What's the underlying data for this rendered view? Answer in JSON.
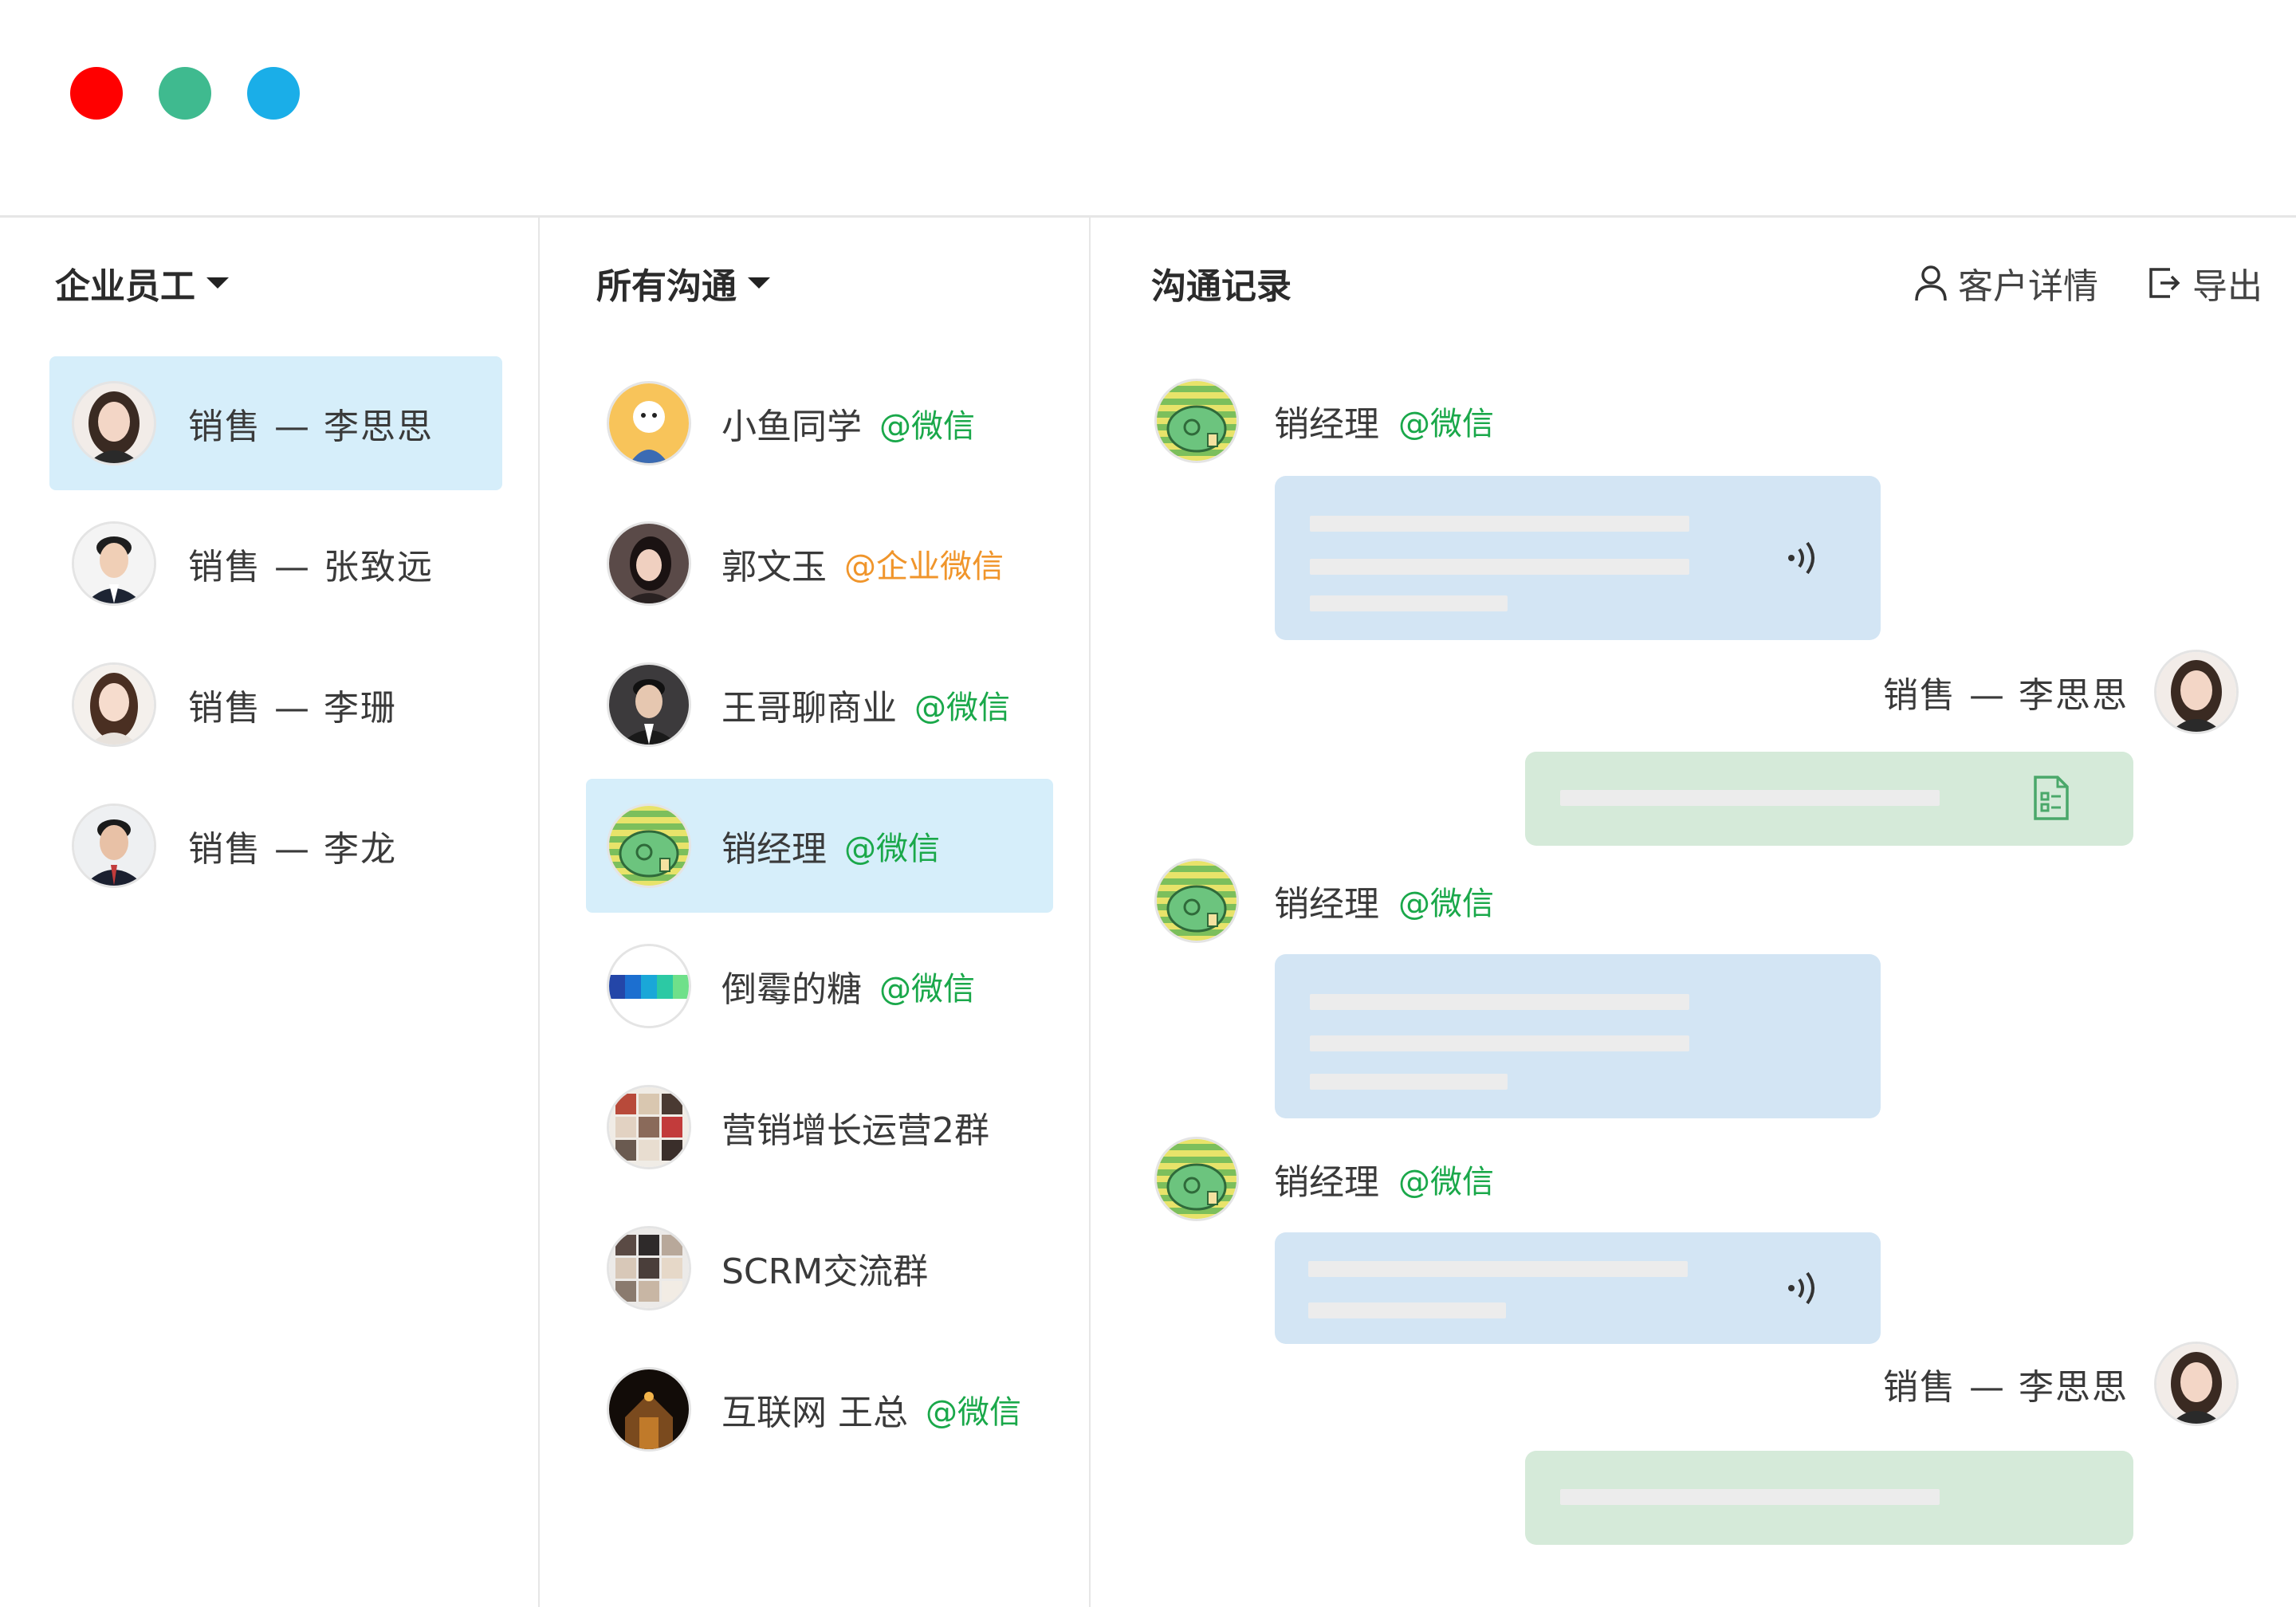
{
  "window": {
    "controls": [
      {
        "name": "close",
        "color": "#ff0000"
      },
      {
        "name": "minimize",
        "color": "#3fba8f"
      },
      {
        "name": "maximize",
        "color": "#1aaee8"
      }
    ]
  },
  "employees": {
    "title": "企业员工",
    "items": [
      {
        "name": "销售 — 李思思",
        "selected": true,
        "avatar": "avatar-female-1"
      },
      {
        "name": "销售 — 张致远",
        "selected": false,
        "avatar": "avatar-male-1"
      },
      {
        "name": "销售 — 李珊",
        "selected": false,
        "avatar": "avatar-female-2"
      },
      {
        "name": "销售 — 李龙",
        "selected": false,
        "avatar": "avatar-male-2"
      }
    ]
  },
  "conversations": {
    "title": "所有沟通",
    "items": [
      {
        "name": "小鱼同学",
        "source": "@微信",
        "source_color": "#1aa84a",
        "selected": false,
        "avatar": "cartoon-avatar"
      },
      {
        "name": "郭文玉",
        "source": "@企业微信",
        "source_color": "#f0952b",
        "selected": false,
        "avatar": "photo-avatar"
      },
      {
        "name": "王哥聊商业",
        "source": "@微信",
        "source_color": "#1aa84a",
        "selected": false,
        "avatar": "photo-avatar"
      },
      {
        "name": "销经理",
        "source": "@微信",
        "source_color": "#1aa84a",
        "selected": true,
        "avatar": "elephant-avatar"
      },
      {
        "name": "倒霉的糖",
        "source": "@微信",
        "source_color": "#1aa84a",
        "selected": false,
        "avatar": "color-bars-avatar"
      },
      {
        "name": "营销增长运营2群",
        "source": "",
        "source_color": "#1aa84a",
        "selected": false,
        "avatar": "group-avatar"
      },
      {
        "name": "SCRM交流群",
        "source": "",
        "source_color": "#1aa84a",
        "selected": false,
        "avatar": "group-avatar"
      },
      {
        "name": "互联网 王总",
        "source": "@微信",
        "source_color": "#1aa84a",
        "selected": false,
        "avatar": "photo-avatar"
      }
    ]
  },
  "records": {
    "title": "沟通记录",
    "customer_detail": "客户详情",
    "export": "导出",
    "messages": [
      {
        "sender": "销经理",
        "source": "@微信",
        "side": "left",
        "bubble": "blue",
        "icon": "voice-icon"
      },
      {
        "sender": "销售 — 李思思",
        "source": "",
        "side": "right",
        "bubble": "green",
        "icon": "document-icon"
      },
      {
        "sender": "销经理",
        "source": "@微信",
        "side": "left",
        "bubble": "blue",
        "icon": ""
      },
      {
        "sender": "销经理",
        "source": "@微信",
        "side": "left",
        "bubble": "blue",
        "icon": "voice-icon"
      },
      {
        "sender": "销售 — 李思思",
        "source": "",
        "side": "right",
        "bubble": "green",
        "icon": ""
      }
    ]
  },
  "colors": {
    "selected_bg": "#d6eefa",
    "wechat_green": "#1aa84a",
    "wework_orange": "#f0952b",
    "bubble_blue": "#d3e5f4",
    "bubble_green": "#d5ead9"
  }
}
